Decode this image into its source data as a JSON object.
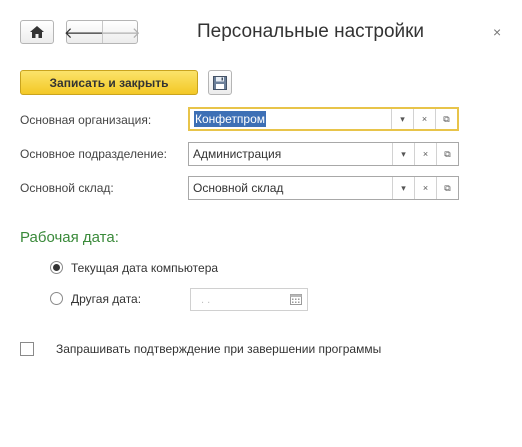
{
  "header": {
    "title": "Персональные настройки",
    "close_glyph": "×",
    "back_glyph": "🡐",
    "forward_glyph": "🡒"
  },
  "toolbar": {
    "save_close_label": "Записать и закрыть"
  },
  "fields": [
    {
      "label": "Основная организация:",
      "value": "Конфетпром",
      "focused": true
    },
    {
      "label": "Основное подразделение:",
      "value": "Администрация",
      "focused": false
    },
    {
      "label": "Основной склад:",
      "value": "Основной склад",
      "focused": false
    }
  ],
  "field_buttons": {
    "dropdown": "▾",
    "clear": "×",
    "open": "⧉"
  },
  "work_date": {
    "section_title": "Рабочая дата:",
    "options": [
      {
        "label": "Текущая дата компьютера",
        "selected": true
      },
      {
        "label": "Другая дата:",
        "selected": false
      }
    ],
    "date_placeholder": ". ."
  },
  "confirm_exit": {
    "label": "Запрашивать подтверждение при завершении программы",
    "checked": false
  },
  "colors": {
    "accent_yellow": "#f3c826",
    "section_green": "#3a8a3a",
    "selection_blue": "#3d6fb5"
  },
  "icons": {
    "home": "home-icon",
    "save": "floppy-disk-icon",
    "calendar": "calendar-icon"
  }
}
